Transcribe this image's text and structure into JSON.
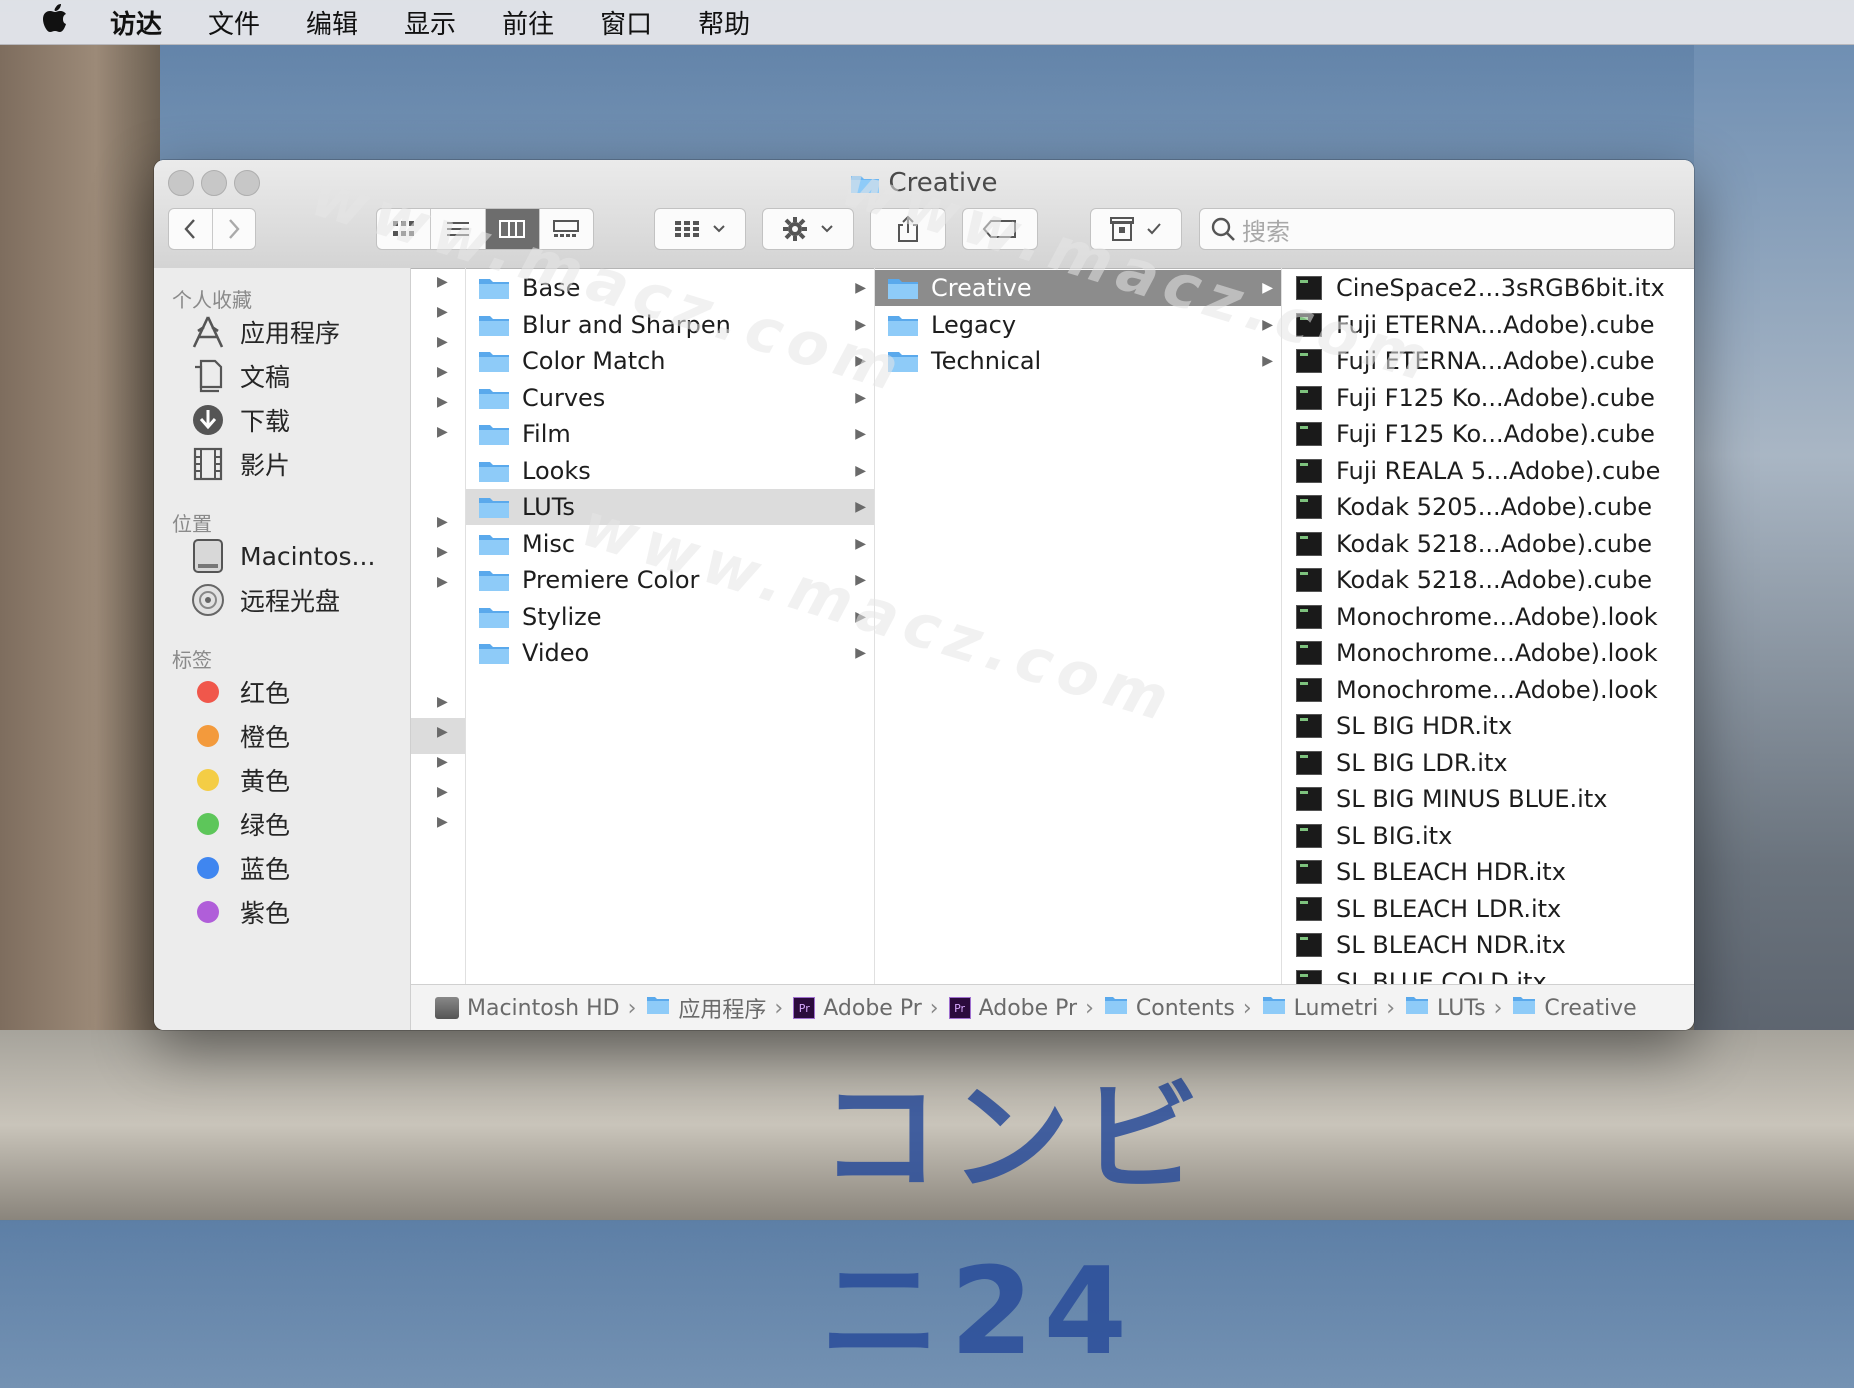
{
  "menubar": {
    "apple_icon": "apple-logo",
    "items": [
      "访达",
      "文件",
      "编辑",
      "显示",
      "前往",
      "窗口",
      "帮助"
    ]
  },
  "window": {
    "title": "Creative",
    "search_placeholder": "搜索"
  },
  "sidebar": {
    "favorites_header": "个人收藏",
    "favorites": [
      {
        "label": "应用程序",
        "icon": "applications-icon"
      },
      {
        "label": "文稿",
        "icon": "documents-icon"
      },
      {
        "label": "下载",
        "icon": "downloads-icon"
      },
      {
        "label": "影片",
        "icon": "movies-icon"
      }
    ],
    "locations_header": "位置",
    "locations": [
      {
        "label": "Macintos...",
        "icon": "hard-drive-icon"
      },
      {
        "label": "远程光盘",
        "icon": "remote-disc-icon"
      }
    ],
    "tags_header": "标签",
    "tags": [
      {
        "label": "红色",
        "color": "#f0574b"
      },
      {
        "label": "橙色",
        "color": "#f39a3c"
      },
      {
        "label": "黄色",
        "color": "#f4cd45"
      },
      {
        "label": "绿色",
        "color": "#5dc65a"
      },
      {
        "label": "蓝色",
        "color": "#3f86f0"
      },
      {
        "label": "紫色",
        "color": "#b05ed9"
      }
    ]
  },
  "column1": [
    "Base",
    "Blur and Sharpen",
    "Color Match",
    "Curves",
    "Film",
    "Looks",
    "LUTs",
    "Misc",
    "Premiere Color",
    "Stylize",
    "Video"
  ],
  "column1_selected": "LUTs",
  "column2": [
    "Creative",
    "Legacy",
    "Technical"
  ],
  "column2_selected": "Creative",
  "column3": [
    "CineSpace2...3sRGB6bit.itx",
    "Fuji ETERNA...Adobe).cube",
    "Fuji ETERNA...Adobe).cube",
    "Fuji F125 Ko...Adobe).cube",
    "Fuji F125 Ko...Adobe).cube",
    "Fuji REALA 5...Adobe).cube",
    "Kodak 5205...Adobe).cube",
    "Kodak 5218...Adobe).cube",
    "Kodak 5218...Adobe).cube",
    "Monochrome...Adobe).look",
    "Monochrome...Adobe).look",
    "Monochrome...Adobe).look",
    "SL BIG HDR.itx",
    "SL BIG LDR.itx",
    "SL BIG MINUS BLUE.itx",
    "SL BIG.itx",
    "SL BLEACH HDR.itx",
    "SL BLEACH LDR.itx",
    "SL BLEACH NDR.itx",
    "SL BLUE COLD.itx"
  ],
  "pathbar": [
    {
      "label": "Macintosh HD",
      "icon": "hard-drive-icon"
    },
    {
      "label": "应用程序",
      "icon": "folder-icon"
    },
    {
      "label": "Adobe Pr",
      "icon": "premiere-icon"
    },
    {
      "label": "Adobe Pr",
      "icon": "premiere-icon"
    },
    {
      "label": "Contents",
      "icon": "folder-icon"
    },
    {
      "label": "Lumetri",
      "icon": "folder-icon"
    },
    {
      "label": "LUTs",
      "icon": "folder-icon"
    },
    {
      "label": "Creative",
      "icon": "folder-icon"
    }
  ],
  "watermark": "www.macz.com"
}
